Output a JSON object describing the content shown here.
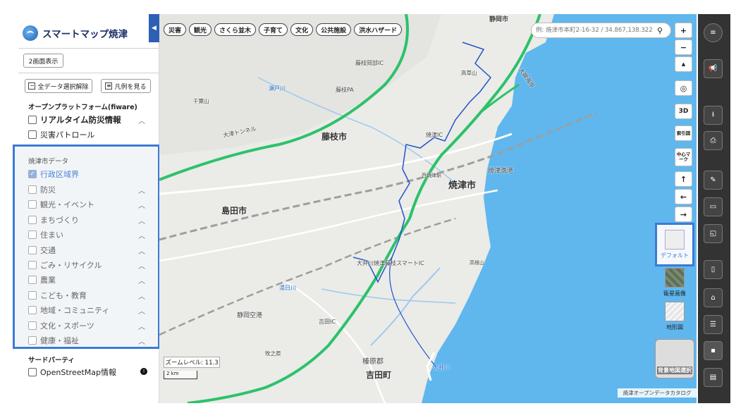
{
  "app": {
    "title": "スマートマップ焼津",
    "collapse_icon": "triangle-left-icon"
  },
  "panel": {
    "dual_view_label": "2画面表示",
    "clear_all_label": "全データ選択解除",
    "legend_label": "凡例を見る",
    "open_platform": {
      "title": "オープンプラットフォーム(fiware)",
      "items": [
        {
          "label": "リアルタイム防災情報",
          "checked": false,
          "expandable": true
        },
        {
          "label": "災害パトロール",
          "checked": false,
          "expandable": false
        }
      ]
    },
    "city_data": {
      "title": "焼津市データ",
      "items": [
        {
          "label": "行政区域界",
          "checked": true
        },
        {
          "label": "防災",
          "checked": false
        },
        {
          "label": "観光・イベント",
          "checked": false
        },
        {
          "label": "まちづくり",
          "checked": false
        },
        {
          "label": "住まい",
          "checked": false
        },
        {
          "label": "交通",
          "checked": false
        },
        {
          "label": "ごみ・リサイクル",
          "checked": false
        },
        {
          "label": "農業",
          "checked": false
        },
        {
          "label": "こども・教育",
          "checked": false
        },
        {
          "label": "地域・コミュニティ",
          "checked": false
        },
        {
          "label": "文化・スポーツ",
          "checked": false
        },
        {
          "label": "健康・福祉",
          "checked": false
        }
      ]
    },
    "third_party": {
      "title": "サードパーティ",
      "items": [
        {
          "label": "OpenStreetMap情報",
          "checked": false
        }
      ]
    },
    "info_icon": "info-icon"
  },
  "map": {
    "category_tabs": [
      "災害",
      "観光",
      "さくら並木",
      "子育て",
      "文化",
      "公共施設",
      "洪水ハザード"
    ],
    "search": {
      "placeholder": "例: 焼津市本町2-16-32 / 34.867,138.322",
      "icon": "search-icon"
    },
    "zoom_in": "+",
    "zoom_out": "−",
    "compass": "▲",
    "mode_3d": "3D",
    "index_map": "索引図",
    "center_mark": "中心マーク",
    "arrow_up": "↑",
    "arrow_left": "←",
    "arrow_right": "→",
    "zoom_level_text": "ズームレベル: 11.3",
    "scale_text": "2 km",
    "credit": "焼津オープンデータカタログ",
    "places": {
      "shizuoka_city": "静岡市",
      "fujieda": "藤枝市",
      "yaizu": "焼津市",
      "shimada": "島田市",
      "yoshida": "吉田町",
      "haibara": "榛原郡",
      "shizuoka_airport": "静岡空港",
      "kannami": "焼津漁港",
      "oigawa_yaizu_fujieda_sic": "大井川焼津藤枝スマートIC",
      "fujieda_okabe_ic": "藤枝岡部IC",
      "fujieda_pa": "藤枝PA",
      "yaizu_ic": "焼津IC",
      "yoshida_ic": "吉田IC",
      "setogawa": "瀬戸川",
      "yumegawa": "湯日川",
      "oigawa": "大井川",
      "takakusayama": "高草山",
      "ootsutunnel": "大津トンネル",
      "senbaya": "千葉山",
      "ohiragawa": "大崩海岸",
      "makinohara": "牧之原",
      "yaizu_station": "西焼津駅",
      "mount_label": "高根山",
      "route1": "1",
      "route150": "150",
      "e1": "E1",
      "e1a": "E1A"
    },
    "basemaps": {
      "default": "デフォルト",
      "satellite": "衛星画像",
      "terrain": "地形図",
      "select": "背景地図選択"
    }
  },
  "toolbar_icons": [
    "menu-icon",
    "megaphone-icon",
    "download-icon",
    "print-icon",
    "draw-icon",
    "ruler-icon",
    "area-icon",
    "book-icon",
    "home-icon",
    "database-icon",
    "layer-icon",
    "document-icon"
  ],
  "colors": {
    "accent": "#3b7ad6",
    "sea": "#5fb7ee",
    "expressway": "#2cc26a",
    "toolbar": "#333333"
  }
}
